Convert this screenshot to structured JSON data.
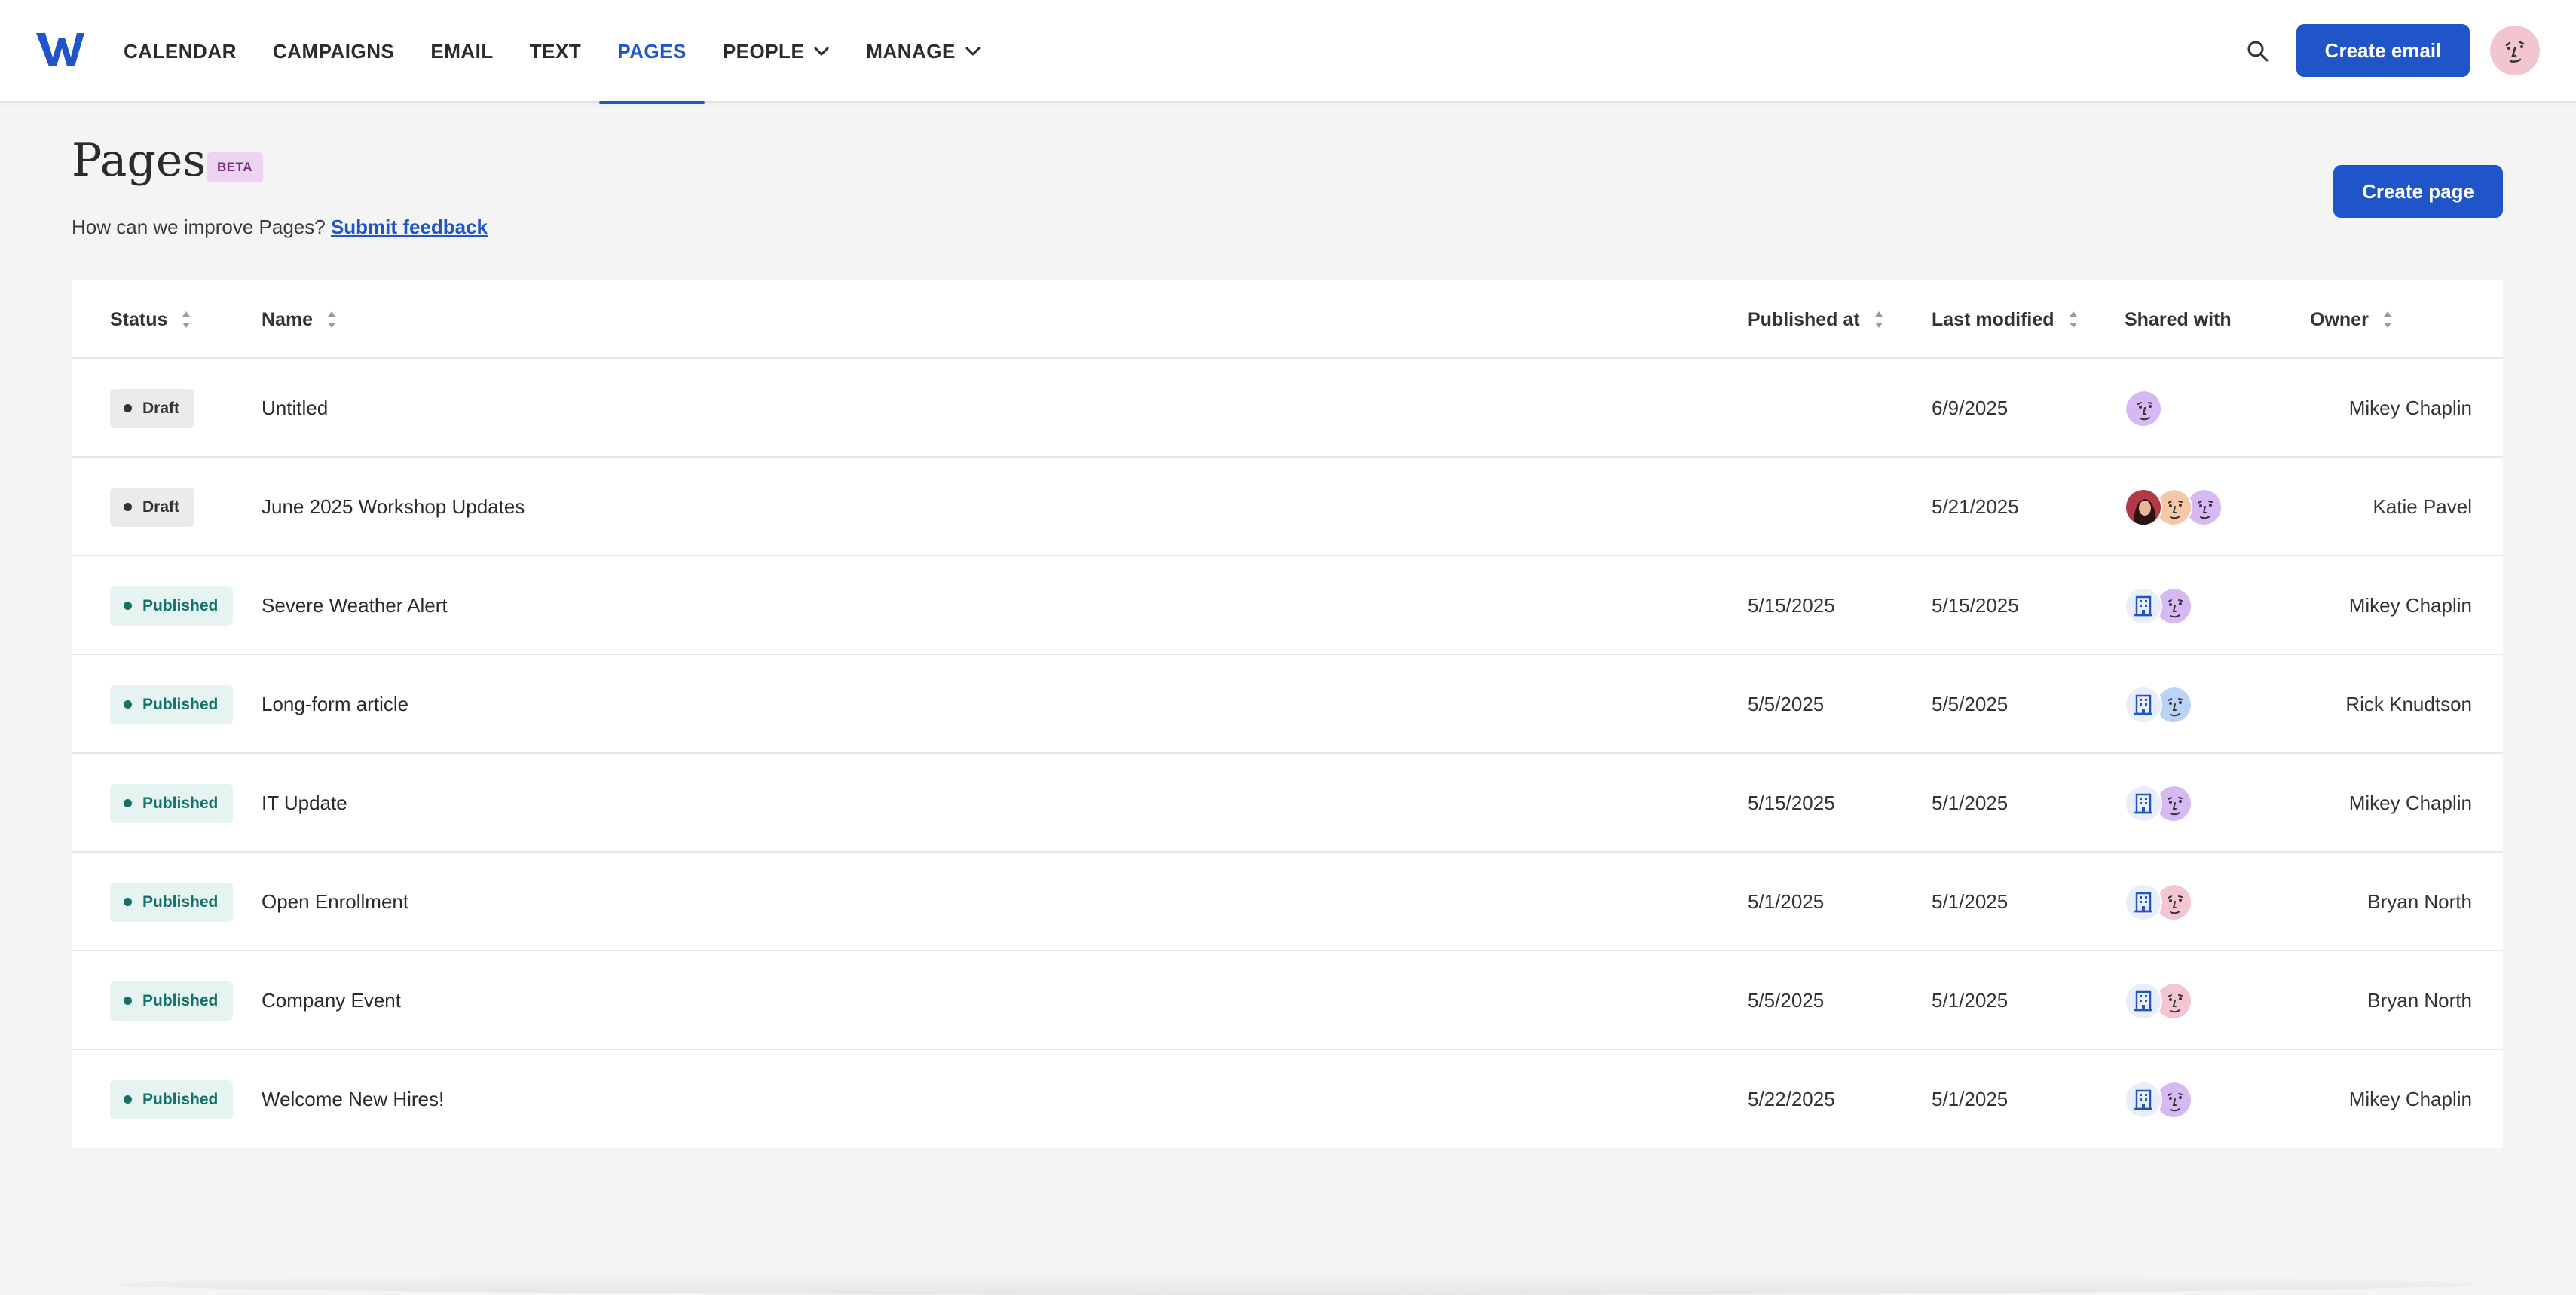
{
  "nav": {
    "items": [
      {
        "label": "CALENDAR",
        "active": false,
        "dropdown": false
      },
      {
        "label": "CAMPAIGNS",
        "active": false,
        "dropdown": false
      },
      {
        "label": "EMAIL",
        "active": false,
        "dropdown": false
      },
      {
        "label": "TEXT",
        "active": false,
        "dropdown": false
      },
      {
        "label": "PAGES",
        "active": true,
        "dropdown": false
      },
      {
        "label": "PEOPLE",
        "active": false,
        "dropdown": true
      },
      {
        "label": "MANAGE",
        "active": false,
        "dropdown": true
      }
    ],
    "create_email_label": "Create email",
    "search_icon": "search-icon",
    "accent_color": "#1f55c8"
  },
  "header": {
    "title": "Pages",
    "badge": "BETA",
    "feedback_prompt": "How can we improve Pages?",
    "feedback_link": "Submit feedback",
    "create_page_label": "Create page"
  },
  "table": {
    "columns": {
      "status": "Status",
      "name": "Name",
      "published_at": "Published at",
      "last_modified": "Last modified",
      "shared_with": "Shared with",
      "owner": "Owner"
    },
    "rows": [
      {
        "status": "Draft",
        "name": "Untitled",
        "published_at": "",
        "last_modified": "6/9/2025",
        "shared": [
          "purple"
        ],
        "owner": "Mikey Chaplin"
      },
      {
        "status": "Draft",
        "name": "June 2025 Workshop Updates",
        "published_at": "",
        "last_modified": "5/21/2025",
        "shared": [
          "photo",
          "peach",
          "purple"
        ],
        "owner": "Katie Pavel"
      },
      {
        "status": "Published",
        "name": "Severe Weather Alert",
        "published_at": "5/15/2025",
        "last_modified": "5/15/2025",
        "shared": [
          "org",
          "purple"
        ],
        "owner": "Mikey Chaplin"
      },
      {
        "status": "Published",
        "name": "Long-form article",
        "published_at": "5/5/2025",
        "last_modified": "5/5/2025",
        "shared": [
          "org",
          "blue"
        ],
        "owner": "Rick Knudtson"
      },
      {
        "status": "Published",
        "name": "IT Update",
        "published_at": "5/15/2025",
        "last_modified": "5/1/2025",
        "shared": [
          "org",
          "purple"
        ],
        "owner": "Mikey Chaplin"
      },
      {
        "status": "Published",
        "name": "Open Enrollment",
        "published_at": "5/1/2025",
        "last_modified": "5/1/2025",
        "shared": [
          "org",
          "pink"
        ],
        "owner": "Bryan North"
      },
      {
        "status": "Published",
        "name": "Company Event",
        "published_at": "5/5/2025",
        "last_modified": "5/1/2025",
        "shared": [
          "org",
          "pink"
        ],
        "owner": "Bryan North"
      },
      {
        "status": "Published",
        "name": "Welcome New Hires!",
        "published_at": "5/22/2025",
        "last_modified": "5/1/2025",
        "shared": [
          "org",
          "purple"
        ],
        "owner": "Mikey Chaplin"
      }
    ]
  },
  "colors": {
    "draft_bg": "#ebebeb",
    "published_bg": "#e6f4f1",
    "published_text": "#14716a",
    "beta_bg": "#ecd3ef"
  }
}
